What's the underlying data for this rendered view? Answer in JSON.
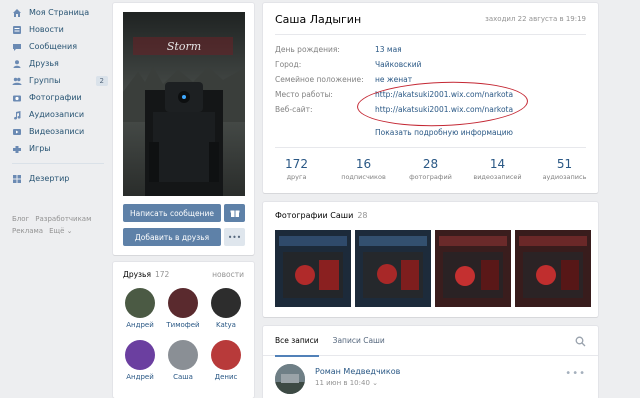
{
  "nav": {
    "items": [
      {
        "label": "Моя Страница",
        "icon": "home-icon"
      },
      {
        "label": "Новости",
        "icon": "news-icon"
      },
      {
        "label": "Сообщения",
        "icon": "messages-icon"
      },
      {
        "label": "Друзья",
        "icon": "friends-icon"
      },
      {
        "label": "Группы",
        "icon": "groups-icon",
        "badge": "2"
      },
      {
        "label": "Фотографии",
        "icon": "camera-icon"
      },
      {
        "label": "Аудиозаписи",
        "icon": "music-icon"
      },
      {
        "label": "Видеозаписи",
        "icon": "video-icon"
      },
      {
        "label": "Игры",
        "icon": "games-icon"
      }
    ],
    "app": {
      "label": "Дезертир",
      "icon": "app-icon"
    },
    "footer": [
      "Блог",
      "Разработчикам",
      "Реклама",
      "Ещё ⌄"
    ]
  },
  "profile": {
    "name": "Саша Ладыгин",
    "online": "заходил 22 августа в 19:19",
    "info": [
      {
        "key": "День рождения:",
        "value": "13 мая"
      },
      {
        "key": "Город:",
        "value": "Чайковский"
      },
      {
        "key": "Семейное положение:",
        "value": "не женат"
      },
      {
        "key": "Место работы:",
        "value": "http://akatsuki2001.wix.com/narkota"
      },
      {
        "key": "Веб-сайт:",
        "value": "http://akatsuki2001.wix.com/narkota"
      }
    ],
    "more": "Показать подробную информацию",
    "stats": [
      {
        "num": "172",
        "label": "друга"
      },
      {
        "num": "16",
        "label": "подписчиков"
      },
      {
        "num": "28",
        "label": "фотографий"
      },
      {
        "num": "14",
        "label": "видеозаписей"
      },
      {
        "num": "51",
        "label": "аудиозапись"
      }
    ]
  },
  "actions": {
    "message": "Написать сообщение",
    "add_friend": "Добавить в друзья",
    "more": "•••"
  },
  "friends": {
    "title": "Друзья",
    "count": "172",
    "updates": "новости",
    "list": [
      "Андрей",
      "Тимофей",
      "Katya",
      "Андрей",
      "Саша",
      "Денис"
    ],
    "colors": [
      "#4b5a44",
      "#5a2a2e",
      "#2d2d2d",
      "#6b3fa0",
      "#8a8f95",
      "#b83a3a"
    ]
  },
  "photos": {
    "title": "Фотографии Саши",
    "count": "28"
  },
  "wall": {
    "tabs": [
      "Все записи",
      "Записи Саши"
    ],
    "post": {
      "author": "Роман Медведчиков",
      "date": "11 июн в 10:40 ⌄"
    },
    "more": "•••"
  },
  "colors": {
    "accent": "#5e81a8",
    "link": "#2a5885",
    "annotation": "#c42834"
  }
}
